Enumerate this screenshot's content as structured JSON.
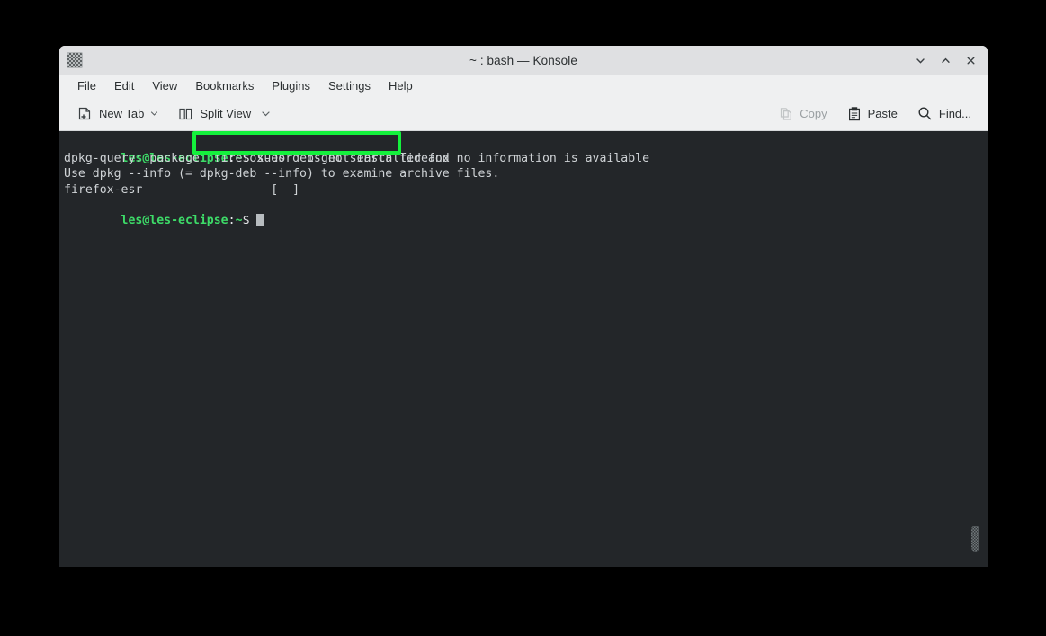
{
  "window": {
    "title": "~ : bash — Konsole",
    "app_icon": "konsole-icon",
    "controls": [
      {
        "name": "minimize-button",
        "icon": "chevron-down-icon"
      },
      {
        "name": "maximize-button",
        "icon": "chevron-up-icon"
      },
      {
        "name": "close-button",
        "icon": "close-icon"
      }
    ]
  },
  "menubar": {
    "items": [
      {
        "label": "File"
      },
      {
        "label": "Edit"
      },
      {
        "label": "View"
      },
      {
        "label": "Bookmarks"
      },
      {
        "label": "Plugins"
      },
      {
        "label": "Settings"
      },
      {
        "label": "Help"
      }
    ]
  },
  "toolbar": {
    "new_tab_label": "New Tab",
    "split_view_label": "Split View",
    "copy_label": "Copy",
    "paste_label": "Paste",
    "find_label": "Find...",
    "copy_enabled": false,
    "paste_enabled": true,
    "find_enabled": true
  },
  "terminal": {
    "colors": {
      "background": "#232629",
      "foreground": "#cfd3d6",
      "prompt_green": "#3ddb68",
      "highlight_green": "#14f03c",
      "cursor": "#b7bcbf"
    },
    "prompt": {
      "user_host": "les@les-eclipse",
      "colon": ":",
      "path": "~",
      "sigil": "$"
    },
    "lines": [
      {
        "type": "prompt",
        "command": "sudo deb-get search firefox",
        "highlighted": true
      },
      {
        "type": "output",
        "text": "dpkg-query: package 'firefox-esr' is not installed and no information is available"
      },
      {
        "type": "output",
        "text": "Use dpkg --info (= dpkg-deb --info) to examine archive files."
      },
      {
        "type": "output",
        "text": "firefox-esr                  [  ]"
      },
      {
        "type": "prompt",
        "command": "",
        "cursor": true,
        "highlighted": false
      }
    ]
  }
}
